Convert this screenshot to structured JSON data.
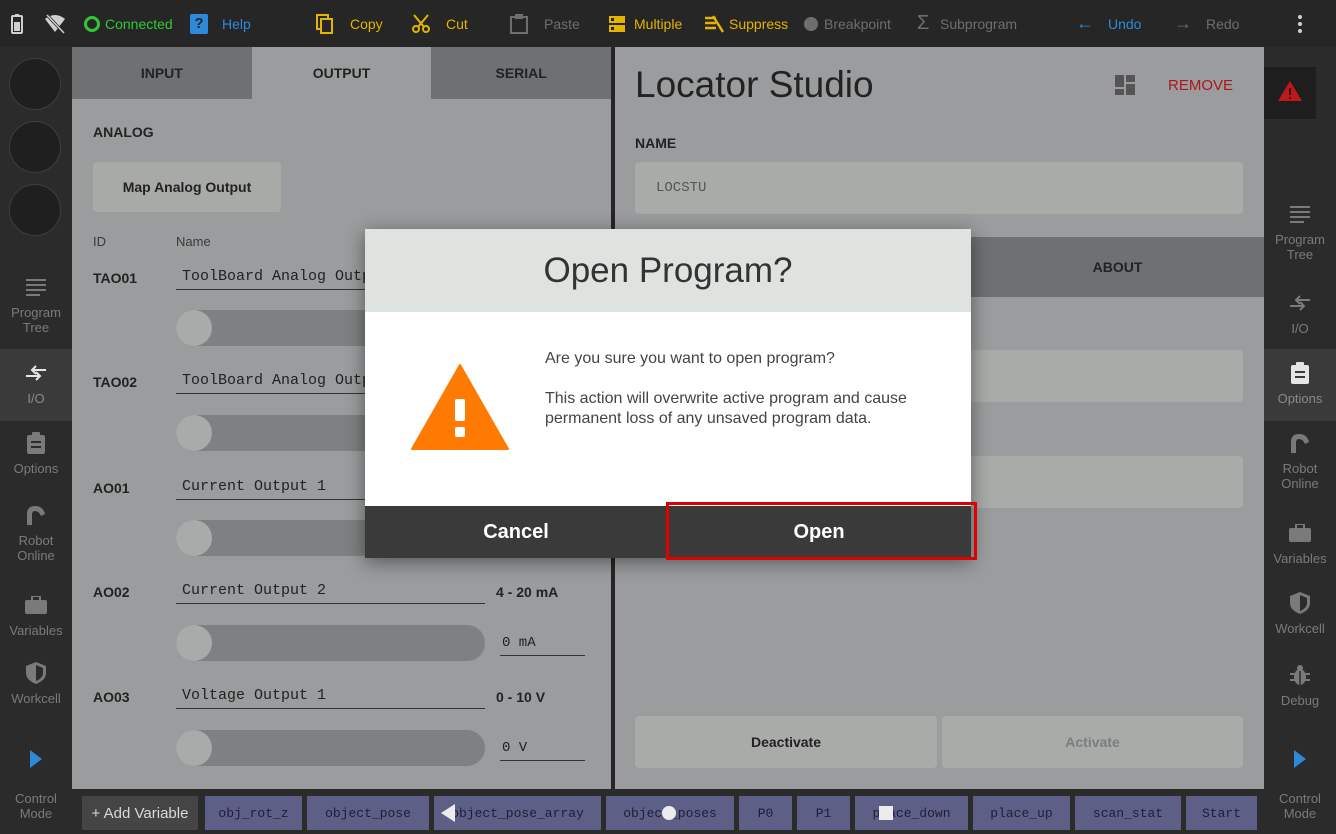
{
  "toolbar": {
    "status": "Connected",
    "help": "Help",
    "copy": "Copy",
    "cut": "Cut",
    "paste": "Paste",
    "multiple": "Multiple",
    "suppress": "Suppress",
    "breakpoint": "Breakpoint",
    "subprogram": "Subprogram",
    "undo": "Undo",
    "redo": "Redo"
  },
  "left_nav": {
    "items": [
      {
        "label": "Program\nTree",
        "icon": "list-icon"
      },
      {
        "label": "I/O",
        "icon": "io-arrows-icon"
      },
      {
        "label": "Options",
        "icon": "clipboard-icon"
      },
      {
        "label": "Robot\nOnline",
        "icon": "robot-arm-icon"
      },
      {
        "label": "Variables",
        "icon": "briefcase-icon"
      },
      {
        "label": "Workcell",
        "icon": "shield-icon"
      }
    ],
    "control_mode": "Control\nMode"
  },
  "right_nav": {
    "items": [
      {
        "label": "Program\nTree",
        "icon": "list-icon"
      },
      {
        "label": "I/O",
        "icon": "io-arrows-icon"
      },
      {
        "label": "Options",
        "icon": "clipboard-icon"
      },
      {
        "label": "Robot\nOnline",
        "icon": "robot-arm-icon"
      },
      {
        "label": "Variables",
        "icon": "briefcase-icon"
      },
      {
        "label": "Workcell",
        "icon": "shield-icon"
      },
      {
        "label": "Debug",
        "icon": "bug-icon"
      }
    ],
    "control_mode": "Control\nMode"
  },
  "io_panel": {
    "tabs": [
      "INPUT",
      "OUTPUT",
      "SERIAL"
    ],
    "active_tab": "OUTPUT",
    "section": "ANALOG",
    "map_button": "Map Analog Output",
    "col_id": "ID",
    "col_name": "Name",
    "rows": [
      {
        "id": "TAO01",
        "name": "ToolBoard Analog Output 1",
        "range": "",
        "value": ""
      },
      {
        "id": "TAO02",
        "name": "ToolBoard Analog Output 2",
        "range": "",
        "value": ""
      },
      {
        "id": "AO01",
        "name": "Current Output 1",
        "range": "",
        "value": ""
      },
      {
        "id": "AO02",
        "name": "Current Output 2",
        "range": "4 - 20 mA",
        "value": "0 mA"
      },
      {
        "id": "AO03",
        "name": "Voltage Output 1",
        "range": "0 - 10 V",
        "value": "0 V"
      }
    ]
  },
  "locator": {
    "title": "Locator Studio",
    "remove": "REMOVE",
    "name_label": "NAME",
    "name_value": "LOCSTU",
    "about_tab": "ABOUT",
    "deactivate": "Deactivate",
    "activate": "Activate"
  },
  "variables_bar": {
    "add": "+ Add Variable",
    "chips": [
      "obj_rot_z",
      "object_pose",
      "object_pose_array",
      "object_poses",
      "P0",
      "P1",
      "place_down",
      "place_up",
      "scan_stat",
      "Start"
    ]
  },
  "dialog": {
    "title": "Open Program?",
    "line1": "Are you sure you want to open program?",
    "line2": "This action will overwrite active program and cause permanent loss of any unsaved program data.",
    "cancel": "Cancel",
    "open": "Open"
  },
  "colors": {
    "accent_yellow": "#e3b400",
    "connected_green": "#32c832",
    "help_blue": "#2e8ad8",
    "warning_orange": "#ff7a00",
    "remove_red": "#b0151b",
    "highlight_red": "#e00000"
  }
}
